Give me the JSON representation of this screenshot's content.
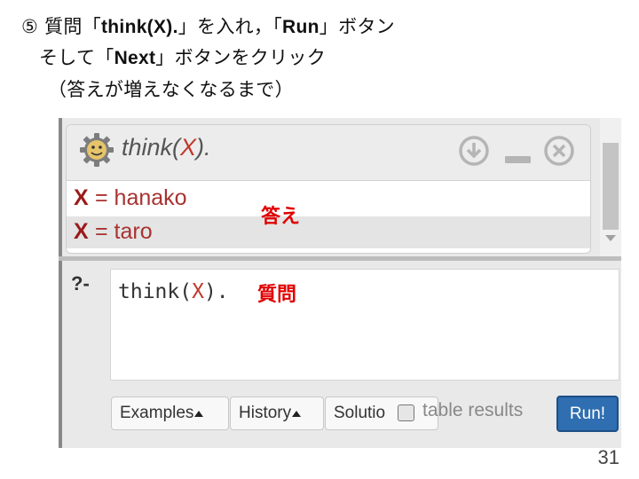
{
  "slide": {
    "line1": {
      "num": "⑤ 質問「",
      "code": "think(X).",
      "mid": "」を入れ，「",
      "run": "Run",
      "end": "」ボタン"
    },
    "line2": {
      "pre": "そして「",
      "next": "Next",
      "post": "」ボタンをクリック"
    },
    "line3": "（答えが増えなくなるまで）",
    "page_number": "31"
  },
  "annotations": {
    "answer": "答え",
    "question": "質問"
  },
  "answer_panel": {
    "query_pre": "think(",
    "query_var": "X",
    "query_post": ").",
    "rows": [
      {
        "var": "X",
        "value": "= hanako"
      },
      {
        "var": "X",
        "value": "= taro"
      }
    ]
  },
  "query_editor": {
    "prompt": "?-",
    "query_pre": "think(",
    "query_var": "X",
    "query_post": ")."
  },
  "toolbar": {
    "examples": "Examples",
    "history": "History",
    "solutions": "Solutio",
    "table_results": "table results",
    "run": "Run!"
  },
  "icons": {
    "logo": "gear-face-icon",
    "download": "download-circle-icon",
    "minimize": "minimize-icon",
    "close": "close-circle-icon"
  },
  "colors": {
    "accent": "#2f6eb0",
    "variable": "#c0392b",
    "annotation": "#e00000"
  }
}
